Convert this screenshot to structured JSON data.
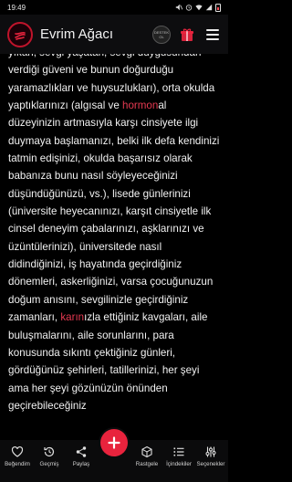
{
  "status_bar": {
    "time": "19:49"
  },
  "header": {
    "title": "Evrim Ağacı",
    "badge_text": "DESTEK OL"
  },
  "article": {
    "segments": [
      {
        "text": "yıkan, sevgi yaşatan, sevgi duygusundan ",
        "link": false
      },
      {
        "text": "verdiği güveni ve bunun doğurduğu yaramazlıkları ve huysuzlukları), orta okulda yaptıklarınızı (algısal ve ",
        "link": false
      },
      {
        "text": "hormon",
        "link": true
      },
      {
        "text": "al düzeyinizin artmasıyla karşı cinsiyete ilgi duymaya başlamanızı, belki ilk defa kendinizi tatmin edişinizi, okulda başarısız olarak babanıza bunu nasıl söyleyeceğinizi düşündüğünüzü, vs.), lisede günlerinizi (üniversite heyecanınızı, karşıt cinsiyetle ilk cinsel deneyim çabalarınızı, aşklarınızı ve üzüntülerinizi), üniversitede nasıl didindiğinizi, iş hayatında geçirdiğiniz dönemleri, askerliğinizi, varsa çocuğunuzun doğum anısını, sevgilinizle geçirdiğiniz zamanları, ",
        "link": false
      },
      {
        "text": "karın",
        "link": true
      },
      {
        "text": "ızla ettiğiniz kavgaları, aile buluşmalarını, aile sorunlarını, para konusunda sıkıntı çektiğiniz günleri, gördüğünüz şehirleri, tatillerinizi, her şeyi ama her şeyi gözünüzün önünden geçirebileceğiniz",
        "link": false
      }
    ]
  },
  "bottom_nav": {
    "items": [
      {
        "label": "Beğendim",
        "icon": "heart-icon"
      },
      {
        "label": "Geçmiş",
        "icon": "history-icon"
      },
      {
        "label": "Paylaş",
        "icon": "share-icon"
      },
      {
        "label": "Rastgele",
        "icon": "dice-icon"
      },
      {
        "label": "İçindekiler",
        "icon": "list-icon"
      },
      {
        "label": "Seçenekler",
        "icon": "sliders-icon"
      }
    ],
    "fab_icon": "plus-icon"
  },
  "colors": {
    "accent": "#e8233d",
    "link": "#e53950",
    "background": "#000000",
    "header_bg": "#0d0d0f"
  }
}
